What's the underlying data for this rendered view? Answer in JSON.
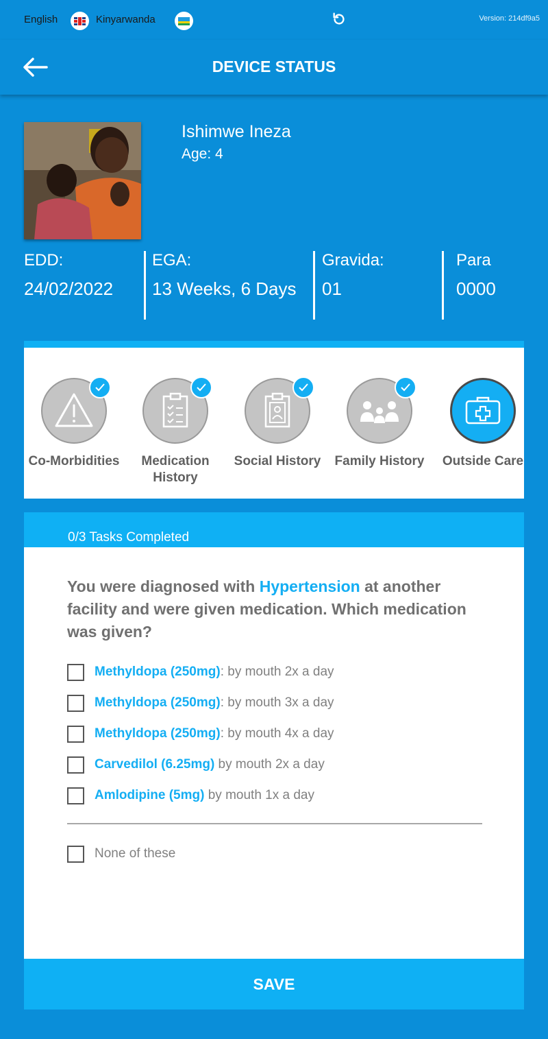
{
  "topbar": {
    "lang_english": "English",
    "lang_kinyarwanda": "Kinyarwanda",
    "version": "Version: 214df9a5"
  },
  "header": {
    "title": "DEVICE STATUS"
  },
  "patient": {
    "name": "Ishimwe Ineza",
    "age": "Age: 4"
  },
  "stats": [
    {
      "label": "EDD:",
      "value": "24/02/2022"
    },
    {
      "label": "EGA:",
      "value": "13 Weeks, 6 Days"
    },
    {
      "label": "Gravida:",
      "value": "01"
    },
    {
      "label": "Para",
      "value": "0000"
    }
  ],
  "categories": [
    {
      "label": "Co-Morbidities",
      "icon": "warning-icon",
      "completed": true
    },
    {
      "label": "Medication History",
      "icon": "clipboard-checklist-icon",
      "completed": true
    },
    {
      "label": "Social History",
      "icon": "clipboard-person-icon",
      "completed": true
    },
    {
      "label": "Family History",
      "icon": "family-icon",
      "completed": true
    },
    {
      "label": "Outside Care",
      "icon": "medical-kit-icon",
      "completed": false,
      "active": true
    }
  ],
  "tasks": {
    "count": "0/3 Tasks Completed",
    "question_pre": "You were diagnosed with ",
    "question_highlight": "Hypertension",
    "question_post": " at another facility and were given medication. Which medication was given?",
    "options": [
      {
        "drug": "Methyldopa (250mg)",
        "detail": ": by mouth 2x a day"
      },
      {
        "drug": "Methyldopa (250mg)",
        "detail": ": by mouth 3x a day"
      },
      {
        "drug": "Methyldopa (250mg)",
        "detail": ": by mouth 4x a day"
      },
      {
        "drug": "Carvedilol (6.25mg)",
        "detail": " by mouth 2x a day"
      },
      {
        "drug": "Amlodipine (5mg)",
        "detail": " by mouth 1x a day"
      }
    ],
    "none_label": "None of these"
  },
  "save_label": "SAVE",
  "colors": {
    "background": "#0a8ed9",
    "accent": "#0fb0f4",
    "text_gray": "#707070"
  }
}
